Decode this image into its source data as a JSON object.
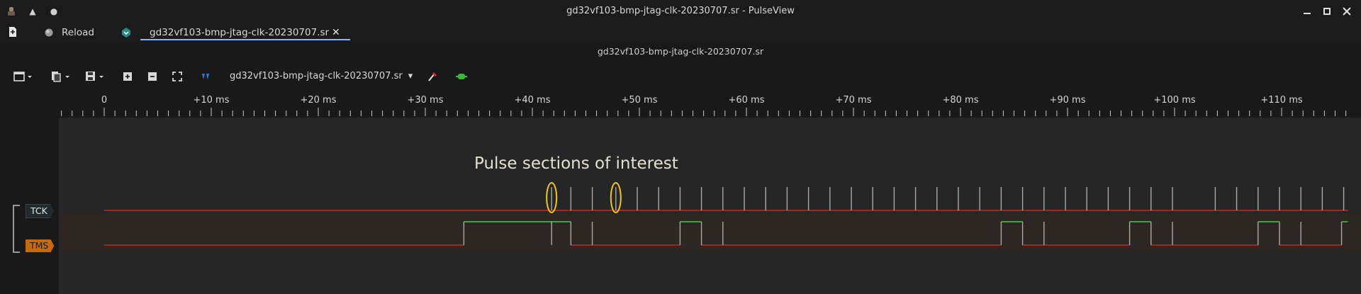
{
  "window": {
    "title": "gd32vf103-bmp-jtag-clk-20230707.sr - PulseView"
  },
  "tabs": {
    "reload_label": "Reload",
    "session_tab": "gd32vf103-bmp-jtag-clk-20230707.sr",
    "close_glyph": "✕"
  },
  "session": {
    "title": "gd32vf103-bmp-jtag-clk-20230707.sr"
  },
  "toolbar": {
    "device_selector": "gd32vf103-bmp-jtag-clk-20230707.sr",
    "dropdown_glyph": "▾"
  },
  "ruler": {
    "labels": [
      "0",
      "+10 ms",
      "+20 ms",
      "+30 ms",
      "+40 ms",
      "+50 ms",
      "+60 ms",
      "+70 ms",
      "+80 ms",
      "+90 ms",
      "+100 ms",
      "+110 ms"
    ],
    "start_ms": 0,
    "end_ms": 116.2,
    "major_step_ms": 10
  },
  "annotation": {
    "text": "Pulse sections of interest"
  },
  "channels": {
    "tck": {
      "label": "TCK"
    },
    "tms": {
      "label": "TMS"
    }
  },
  "signals": {
    "tck_pulse_ms": [
      41.8,
      43.6,
      45.6,
      47.8,
      49.8,
      51.8,
      53.8,
      55.8,
      57.8,
      59.8,
      61.8,
      63.8,
      65.8,
      67.8,
      69.8,
      71.8,
      73.8,
      75.8,
      77.8,
      79.8,
      81.8,
      83.8,
      85.8,
      87.8,
      89.8,
      91.8,
      93.8,
      95.8,
      97.8,
      99.8,
      103.8,
      105.8,
      107.8,
      109.8,
      111.8,
      113.8,
      115.8
    ],
    "tms_high_ms": [
      [
        33.6,
        43.6
      ],
      [
        53.8,
        55.8
      ],
      [
        83.8,
        85.8
      ],
      [
        95.8,
        97.8
      ],
      [
        107.8,
        109.8
      ],
      [
        115.6,
        116.2
      ]
    ],
    "tms_edges_ms": [
      41.8,
      45.6,
      57.8,
      87.8,
      99.8,
      111.8
    ]
  },
  "highlights_ms": [
    41.8,
    47.8
  ],
  "colors": {
    "low_line": "#c8281e",
    "high_line": "#3cd23c",
    "pulse_line": "#a8a8a8",
    "highlight": "#f2c618",
    "accent": "#8ab4f8"
  }
}
